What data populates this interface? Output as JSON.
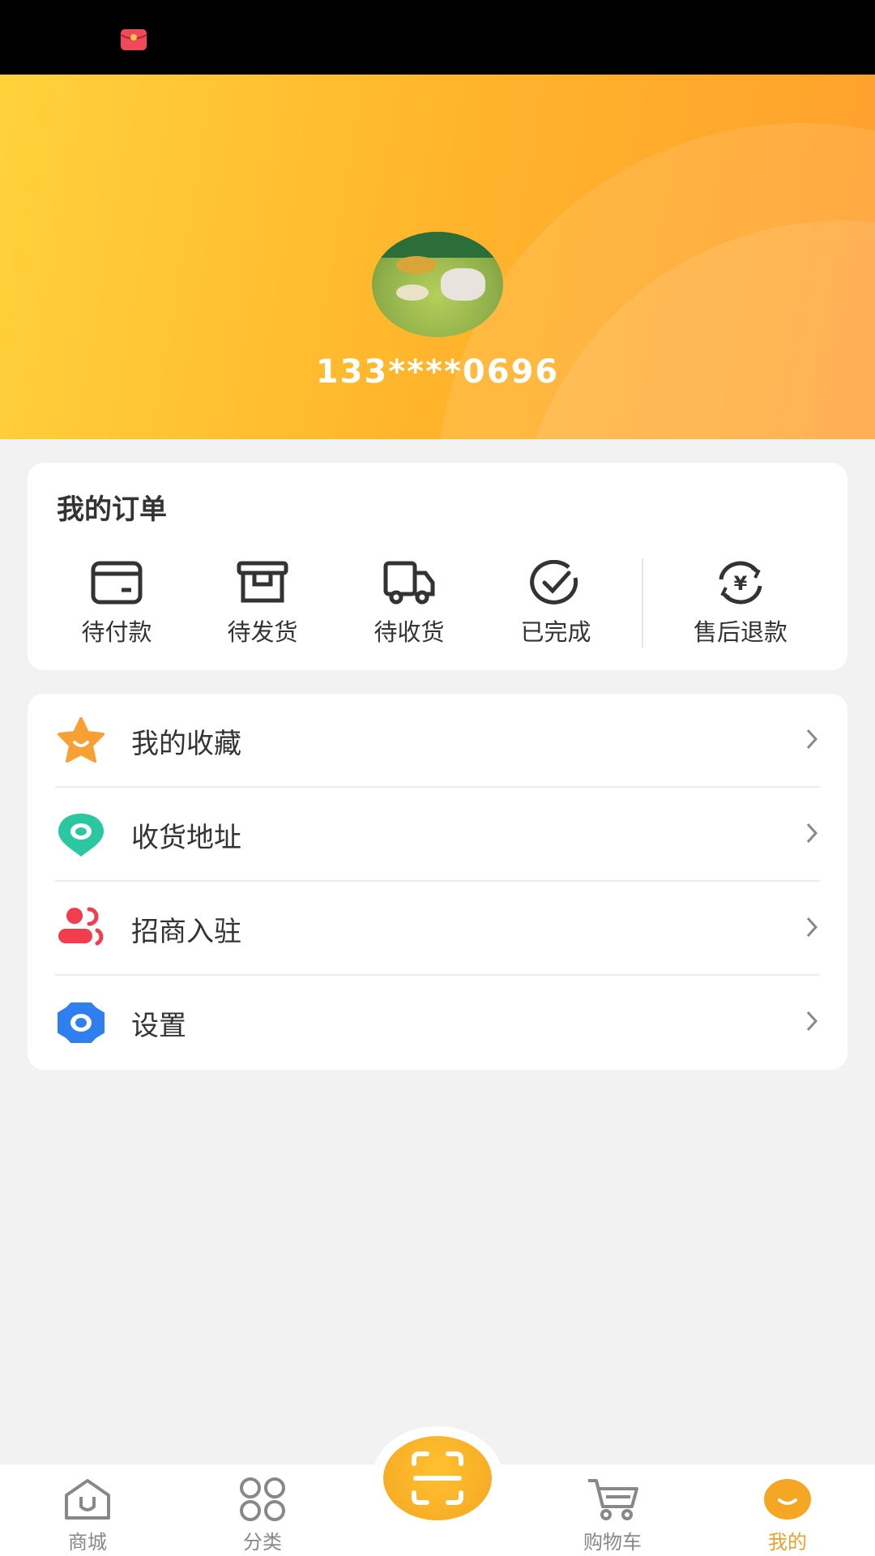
{
  "status_bar": {
    "notification_icon": "red-envelope-icon"
  },
  "profile": {
    "phone": "133****0696"
  },
  "orders": {
    "title": "我的订单",
    "items": [
      {
        "label": "待付款",
        "icon": "wallet-icon"
      },
      {
        "label": "待发货",
        "icon": "box-icon"
      },
      {
        "label": "待收货",
        "icon": "truck-icon"
      },
      {
        "label": "已完成",
        "icon": "check-circle-icon"
      },
      {
        "label": "售后退款",
        "icon": "refund-icon"
      }
    ]
  },
  "menu": {
    "items": [
      {
        "label": "我的收藏",
        "icon": "star-icon",
        "color": "#f7a033"
      },
      {
        "label": "收货地址",
        "icon": "location-icon",
        "color": "#2bc7a0"
      },
      {
        "label": "招商入驻",
        "icon": "users-icon",
        "color": "#f23d4f"
      },
      {
        "label": "设置",
        "icon": "gear-icon",
        "color": "#2f7ff0"
      }
    ]
  },
  "tabbar": {
    "items": [
      {
        "label": "商城",
        "icon": "home-icon"
      },
      {
        "label": "分类",
        "icon": "category-icon"
      },
      {
        "label": "购物车",
        "icon": "cart-icon"
      },
      {
        "label": "我的",
        "icon": "me-icon",
        "active": true
      }
    ],
    "center_icon": "scan-icon"
  },
  "colors": {
    "accent": "#f5a623",
    "header_start": "#ffd23a",
    "header_end": "#ff9f2d"
  }
}
